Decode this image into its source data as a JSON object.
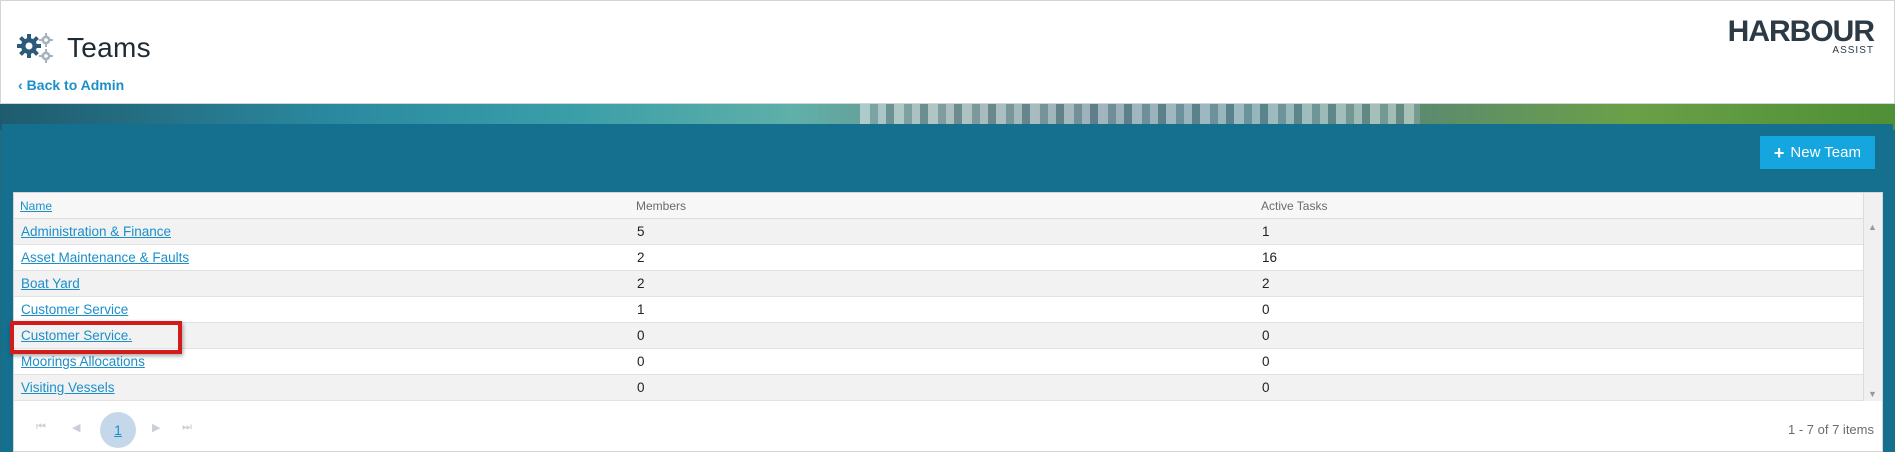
{
  "header": {
    "title": "Teams",
    "back_label": "Back to Admin",
    "logo_text": "HARBOUR",
    "logo_sub": "ASSIST"
  },
  "toolbar": {
    "new_team_label": "New Team"
  },
  "grid": {
    "columns": [
      "Name",
      "Members",
      "Active Tasks"
    ],
    "rows": [
      {
        "name": "Administration & Finance",
        "members": "5",
        "active_tasks": "1"
      },
      {
        "name": "Asset Maintenance & Faults",
        "members": "2",
        "active_tasks": "16"
      },
      {
        "name": "Boat Yard",
        "members": "2",
        "active_tasks": "2"
      },
      {
        "name": "Customer Service",
        "members": "1",
        "active_tasks": "0"
      },
      {
        "name": "Customer Service.",
        "members": "0",
        "active_tasks": "0"
      },
      {
        "name": "Moorings Allocations",
        "members": "0",
        "active_tasks": "0"
      },
      {
        "name": "Visiting Vessels",
        "members": "0",
        "active_tasks": "0"
      }
    ]
  },
  "pager": {
    "current_page": "1",
    "info": "1 - 7 of 7 items"
  },
  "colors": {
    "accent": "#15a6e0",
    "link": "#1b8fc9",
    "panel": "#15708f",
    "highlight": "#d11c1c"
  }
}
